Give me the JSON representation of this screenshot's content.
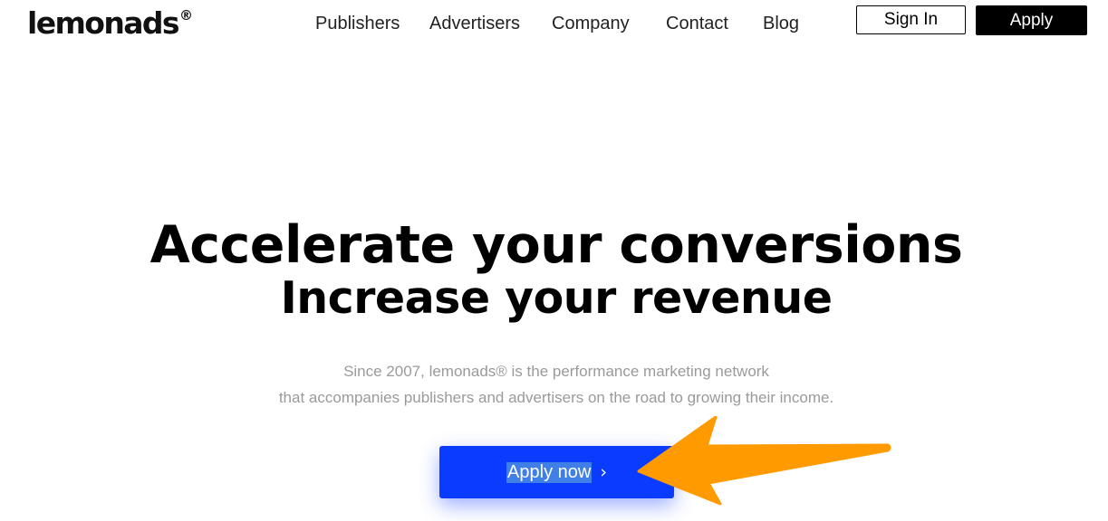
{
  "header": {
    "logo_text": "lemonads",
    "logo_mark": "®",
    "nav": [
      {
        "label": "Publishers"
      },
      {
        "label": "Advertisers"
      },
      {
        "label": "Company"
      },
      {
        "label": "Contact"
      },
      {
        "label": "Blog"
      }
    ],
    "signin_label": "Sign In",
    "apply_label": "Apply"
  },
  "hero": {
    "title": "Accelerate your conversions",
    "subtitle": "Increase your revenue",
    "description_line1": "Since 2007, lemonads® is the performance marketing network",
    "description_line2": "that accompanies publishers and advertisers on the road to growing their income.",
    "cta_label": "Apply now",
    "cta_chevron": "›"
  },
  "colors": {
    "cta_background": "#0a3cff",
    "annotation_arrow": "#ff9a00"
  },
  "icons": {
    "cta_icon": "chevron-right-icon",
    "annotation": "orange-arrow-pointer"
  }
}
